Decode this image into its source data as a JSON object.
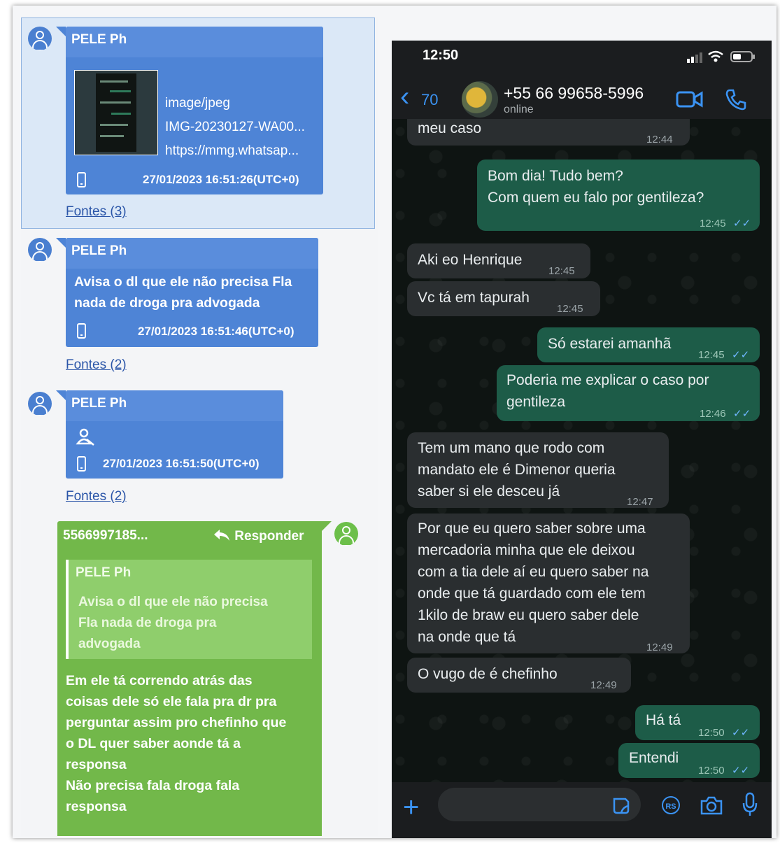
{
  "left_pane": {
    "msg1": {
      "sender": "PELE Ph",
      "attachment_type": "image/jpeg",
      "attachment_name": "IMG-20230127-WA00...",
      "attachment_url": "https://mmg.whatsap...",
      "timestamp": "27/01/2023 16:51:26(UTC+0)",
      "fontes": "Fontes (3)"
    },
    "msg2": {
      "sender": "PELE Ph",
      "text_lines": [
        "Avisa o dl que ele não precisa Fla",
        "nada de droga pra advogada"
      ],
      "timestamp": "27/01/2023 16:51:46(UTC+0)",
      "fontes": "Fontes (2)"
    },
    "msg3": {
      "sender": "PELE Ph",
      "timestamp": "27/01/2023 16:51:50(UTC+0)",
      "fontes": "Fontes (2)"
    },
    "msg4": {
      "sender": "5566997185...",
      "reply_label": "Responder",
      "quote_sender": "PELE Ph",
      "quote_lines": [
        "Avisa o dl que ele não precisa",
        "Fla nada de droga pra",
        "advogada"
      ],
      "text_lines": [
        "Em ele tá correndo atrás das",
        "coisas dele só ele fala pra dr pra",
        "perguntar assim pro chefinho que",
        "o DL quer saber aonde tá a",
        "responsa",
        "Não precisa fala droga fala",
        "responsa"
      ]
    }
  },
  "phone": {
    "clock": "12:50",
    "back_count": "70",
    "contact": "+55 66 99658-5996",
    "status": "online",
    "messages": [
      {
        "text": "meu caso",
        "time": "12:44"
      },
      {
        "text1": "Bom dia! Tudo bem?",
        "text2": "Com quem eu falo por gentileza?",
        "time": "12:45"
      },
      {
        "text": "Aki eo Henrique",
        "time": "12:45"
      },
      {
        "text": "Vc tá em tapurah",
        "time": "12:45"
      },
      {
        "text": "Só estarei amanhã",
        "time": "12:45"
      },
      {
        "text1": "Poderia me explicar o caso por",
        "text2": "gentileza",
        "time": "12:46"
      },
      {
        "text1": "Tem um mano que rodo com",
        "text2": "mandato ele é Dimenor queria",
        "text3": "saber si ele desceu já",
        "time": "12:47"
      },
      {
        "text1": "Por que eu quero saber sobre uma",
        "text2": "mercadoria minha que ele deixou",
        "text3": "com a tia dele aí eu quero saber na",
        "text4": "onde que tá guardado com ele tem",
        "text5": "1kilo de braw eu quero saber dele",
        "text6": "na onde que tá",
        "time": "12:49"
      },
      {
        "text": "O vugo de é chefinho",
        "time": "12:49"
      },
      {
        "text": "Há tá",
        "time": "12:50"
      },
      {
        "text": "Entendi",
        "time": "12:50"
      }
    ],
    "ticks": "✓✓",
    "plus": "+",
    "back_arrow": "‹",
    "rs_label": "RS"
  },
  "colors": {
    "blue_bubble": "#4e84d6",
    "green_bubble": "#72b84a",
    "wa_out": "#1d5c48",
    "wa_in": "#2a2e30"
  }
}
